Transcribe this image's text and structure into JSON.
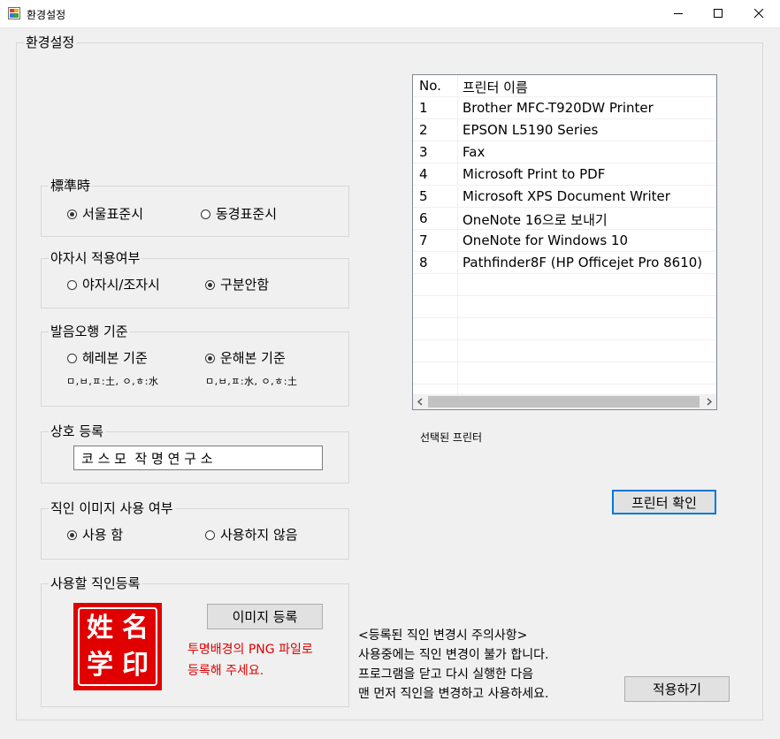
{
  "window": {
    "title": "환경설정",
    "min_label": "minimize",
    "max_label": "maximize",
    "close_label": "close"
  },
  "main_group": {
    "label": "환경설정"
  },
  "standard_time": {
    "label": "標準時",
    "options": [
      {
        "label": "서울표준시",
        "checked": true
      },
      {
        "label": "동경표준시",
        "checked": false
      }
    ]
  },
  "night_time": {
    "label": "야자시 적용여부",
    "options": [
      {
        "label": "야자시/조자시",
        "checked": false
      },
      {
        "label": "구분안함",
        "checked": true
      }
    ]
  },
  "pronunciation": {
    "label": "발음오행 기준",
    "options": [
      {
        "label": "헤레본 기준",
        "checked": false,
        "note": "ㅁ,ㅂ,ㅍ:土, ㅇ,ㅎ:水"
      },
      {
        "label": "운해본 기준",
        "checked": true,
        "note": "ㅁ,ㅂ,ㅍ:水, ㅇ,ㅎ:土"
      }
    ]
  },
  "business_name": {
    "label": "상호 등록",
    "value": "코 스 모  작 명 연 구 소"
  },
  "seal_use": {
    "label": "직인 이미지 사용 여부",
    "options": [
      {
        "label": "사용 함",
        "checked": true
      },
      {
        "label": "사용하지 않음",
        "checked": false
      }
    ]
  },
  "seal_register": {
    "label": "사용할 직인등록",
    "seal_chars": [
      "姓",
      "名",
      "学",
      "印"
    ],
    "button": "이미지 등록",
    "hint_line1": "투명배경의 PNG 파일로",
    "hint_line2": "등록해 주세요."
  },
  "printer_list": {
    "headers": [
      "No.",
      "프린터 이름"
    ],
    "rows": [
      {
        "no": "1",
        "name": "Brother MFC-T920DW Printer"
      },
      {
        "no": "2",
        "name": "EPSON L5190 Series"
      },
      {
        "no": "3",
        "name": "Fax"
      },
      {
        "no": "4",
        "name": "Microsoft Print to PDF"
      },
      {
        "no": "5",
        "name": "Microsoft XPS Document Writer"
      },
      {
        "no": "6",
        "name": "OneNote 16으로 보내기"
      },
      {
        "no": "7",
        "name": "OneNote for Windows 10"
      },
      {
        "no": "8",
        "name": "Pathfinder8F (HP Officejet Pro 8610)"
      }
    ]
  },
  "selected_printer_label": "선택된 프린터",
  "printer_confirm_button": "프린터 확인",
  "notice": {
    "line1": "<등록된 직인 변경시 주의사항>",
    "line2": "사용중에는 직인 변경이 불가 합니다.",
    "line3": "프로그램을 닫고 다시 실행한 다음",
    "line4": "맨 먼저 직인을 변경하고 사용하세요."
  },
  "apply_button": "적용하기",
  "colors": {
    "seal_red": "#e00000",
    "hint_red": "#e00000",
    "focus_blue": "#0078d7"
  }
}
